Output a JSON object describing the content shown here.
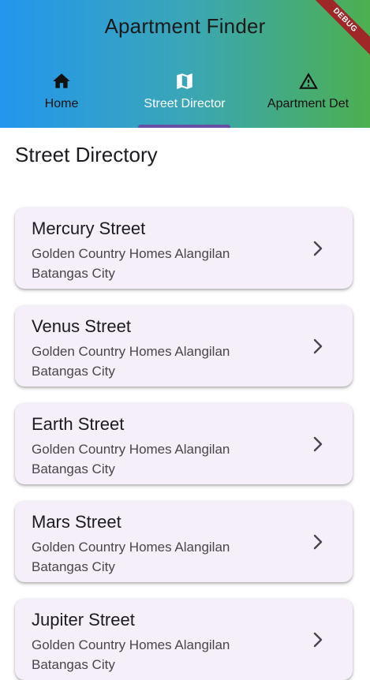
{
  "app_bar": {
    "title": "Apartment Finder",
    "debug_label": "DEBUG",
    "tabs": [
      {
        "label": "Home",
        "icon": "home-icon",
        "selected": false
      },
      {
        "label": "Street Director",
        "icon": "map-icon",
        "selected": true
      },
      {
        "label": "Apartment Det",
        "icon": "warning-icon",
        "selected": false
      }
    ]
  },
  "page": {
    "title": "Street Directory"
  },
  "streets": [
    {
      "name": "Mercury Street",
      "address": "Golden Country Homes Alangilan Batangas City"
    },
    {
      "name": "Venus Street",
      "address": "Golden Country Homes Alangilan Batangas City"
    },
    {
      "name": "Earth Street",
      "address": "Golden Country Homes Alangilan Batangas City"
    },
    {
      "name": "Mars Street",
      "address": "Golden Country Homes Alangilan Batangas City"
    },
    {
      "name": "Jupiter Street",
      "address": "Golden Country Homes Alangilan Batangas City"
    }
  ],
  "colors": {
    "gradient_start": "#2396ee",
    "gradient_end": "#4caf50",
    "tab_indicator": "#6750a4",
    "card_background": "#f4eff8",
    "debug_ribbon": "#a02727"
  }
}
